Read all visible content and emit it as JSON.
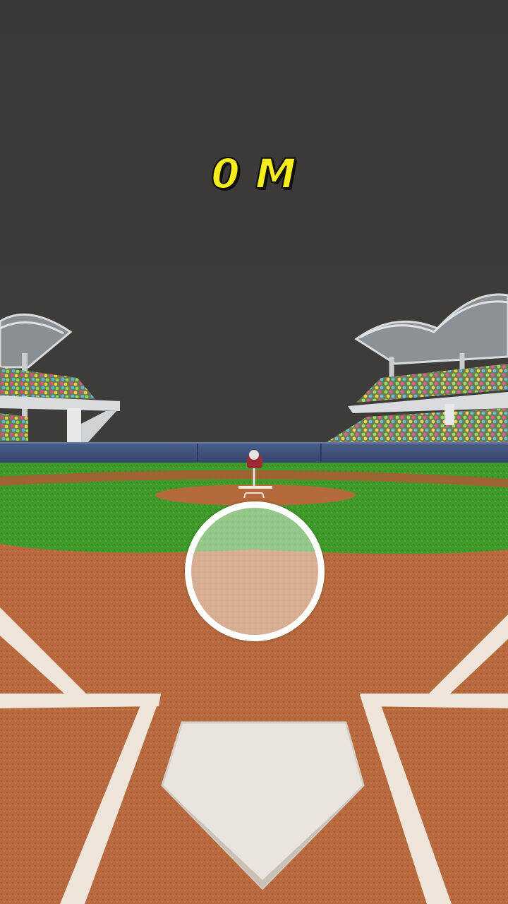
{
  "hud": {
    "distance_text": "0 M"
  },
  "colors": {
    "sky": "#3d3b38",
    "grass": "#3f9a2a",
    "dirt": "#b8693c",
    "chalk": "#efe6dc",
    "distance_text": "#f7ee1a",
    "wall": "#3c4f7a"
  },
  "icons": {
    "reticle": "aim-circle",
    "plate": "home-plate",
    "pitcher": "pitching-machine"
  }
}
